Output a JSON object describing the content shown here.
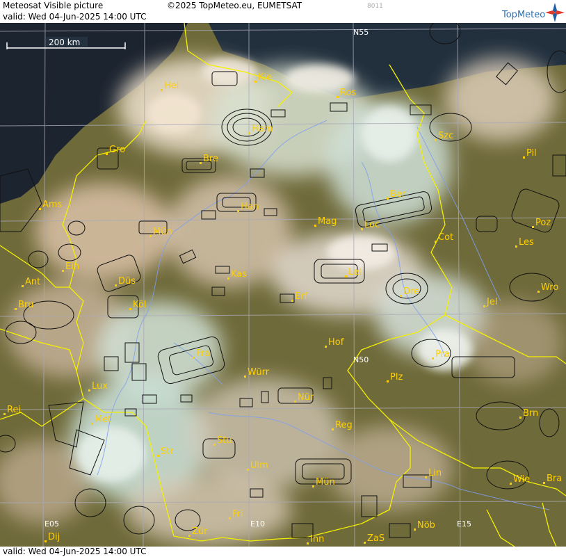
{
  "header": {
    "title": "Meteosat Visible picture",
    "copyright": "©2025 TopMeteo.eu, EUMETSAT",
    "code": "8011",
    "valid": "valid:  Wed  04-Jun-2025  14:00 UTC",
    "logo": "TopMeteo"
  },
  "scale_bar": {
    "label": "200 km"
  },
  "grid_labels": {
    "n55": "N55",
    "n50": "N50",
    "e05": "E05",
    "e10": "E10",
    "e15": "E15"
  },
  "cities": [
    "Hel",
    "Kie",
    "Ros",
    "Ham",
    "Szc",
    "Gro",
    "Bre",
    "Pil",
    "Ber",
    "Ams",
    "Han",
    "Poz",
    "Mag",
    "Loc",
    "Mün",
    "Cot",
    "Les",
    "Ein",
    "Kas",
    "Lei",
    "Ant",
    "Düs",
    "Dre",
    "Wro",
    "Bru",
    "Köl",
    "Erf",
    "Jel",
    "Hof",
    "Fra",
    "Pra",
    "Würr",
    "Plz",
    "Lux",
    "Nür",
    "Rei",
    "Met",
    "Brn",
    "Reg",
    "Stu",
    "Str",
    "Ulm",
    "Lin",
    "Mün",
    "Wie",
    "Bra",
    "Fri",
    "Dij",
    "Zür",
    "Inn",
    "ZaS",
    "Nöb"
  ],
  "colors": {
    "border": "#f4f000",
    "river": "#7f9ff0",
    "grid": "#a9a9b8",
    "city": "#ffd000"
  },
  "footer": {
    "valid": "valid:  Wed  04-Jun-2025  14:00 UTC"
  }
}
